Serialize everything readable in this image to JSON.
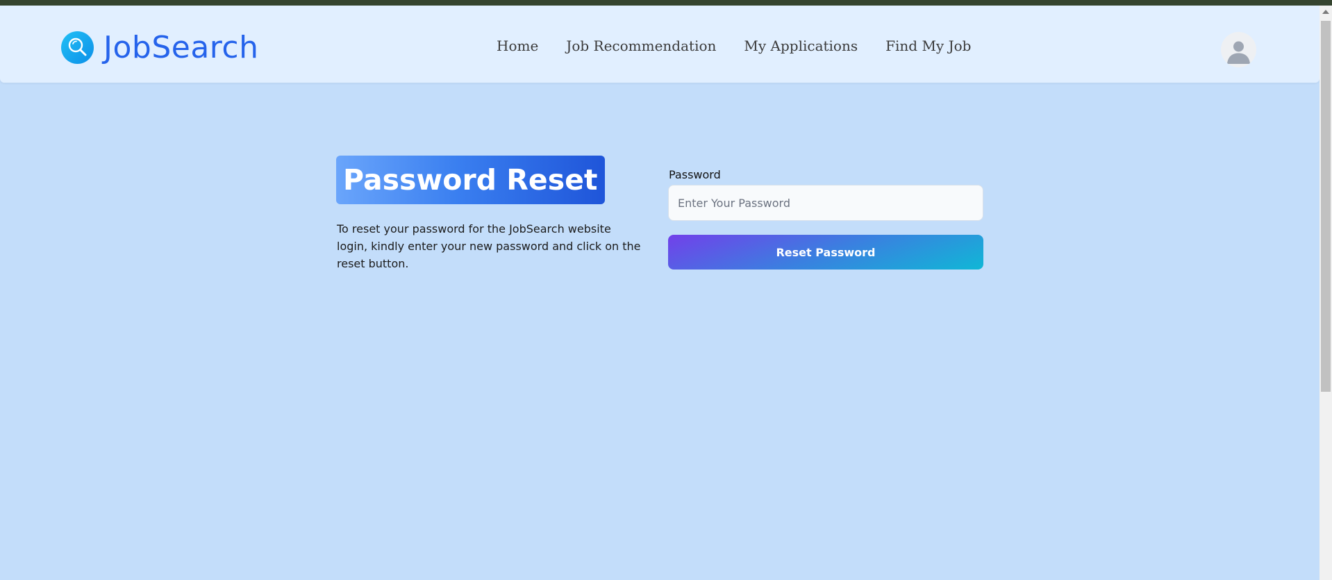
{
  "brand": {
    "name": "JobSearch",
    "icon": "search-icon",
    "color": "#2563eb"
  },
  "nav": {
    "items": [
      {
        "label": "Home"
      },
      {
        "label": "Job Recommendation"
      },
      {
        "label": "My Applications"
      },
      {
        "label": "Find My Job"
      }
    ]
  },
  "user": {
    "avatar_icon": "user-avatar-icon"
  },
  "page": {
    "title": "Password Reset",
    "description": "To reset your password for the JobSearch website login, kindly enter your new password and click on the reset button."
  },
  "form": {
    "password_label": "Password",
    "password_placeholder": "Enter Your Password",
    "password_value": "",
    "submit_label": "Reset Password"
  },
  "colors": {
    "background": "#c3ddfa",
    "navbar": "#e1efff",
    "accent": "#2563eb",
    "button_gradient_start": "#7240ea",
    "button_gradient_end": "#10b7d6"
  }
}
